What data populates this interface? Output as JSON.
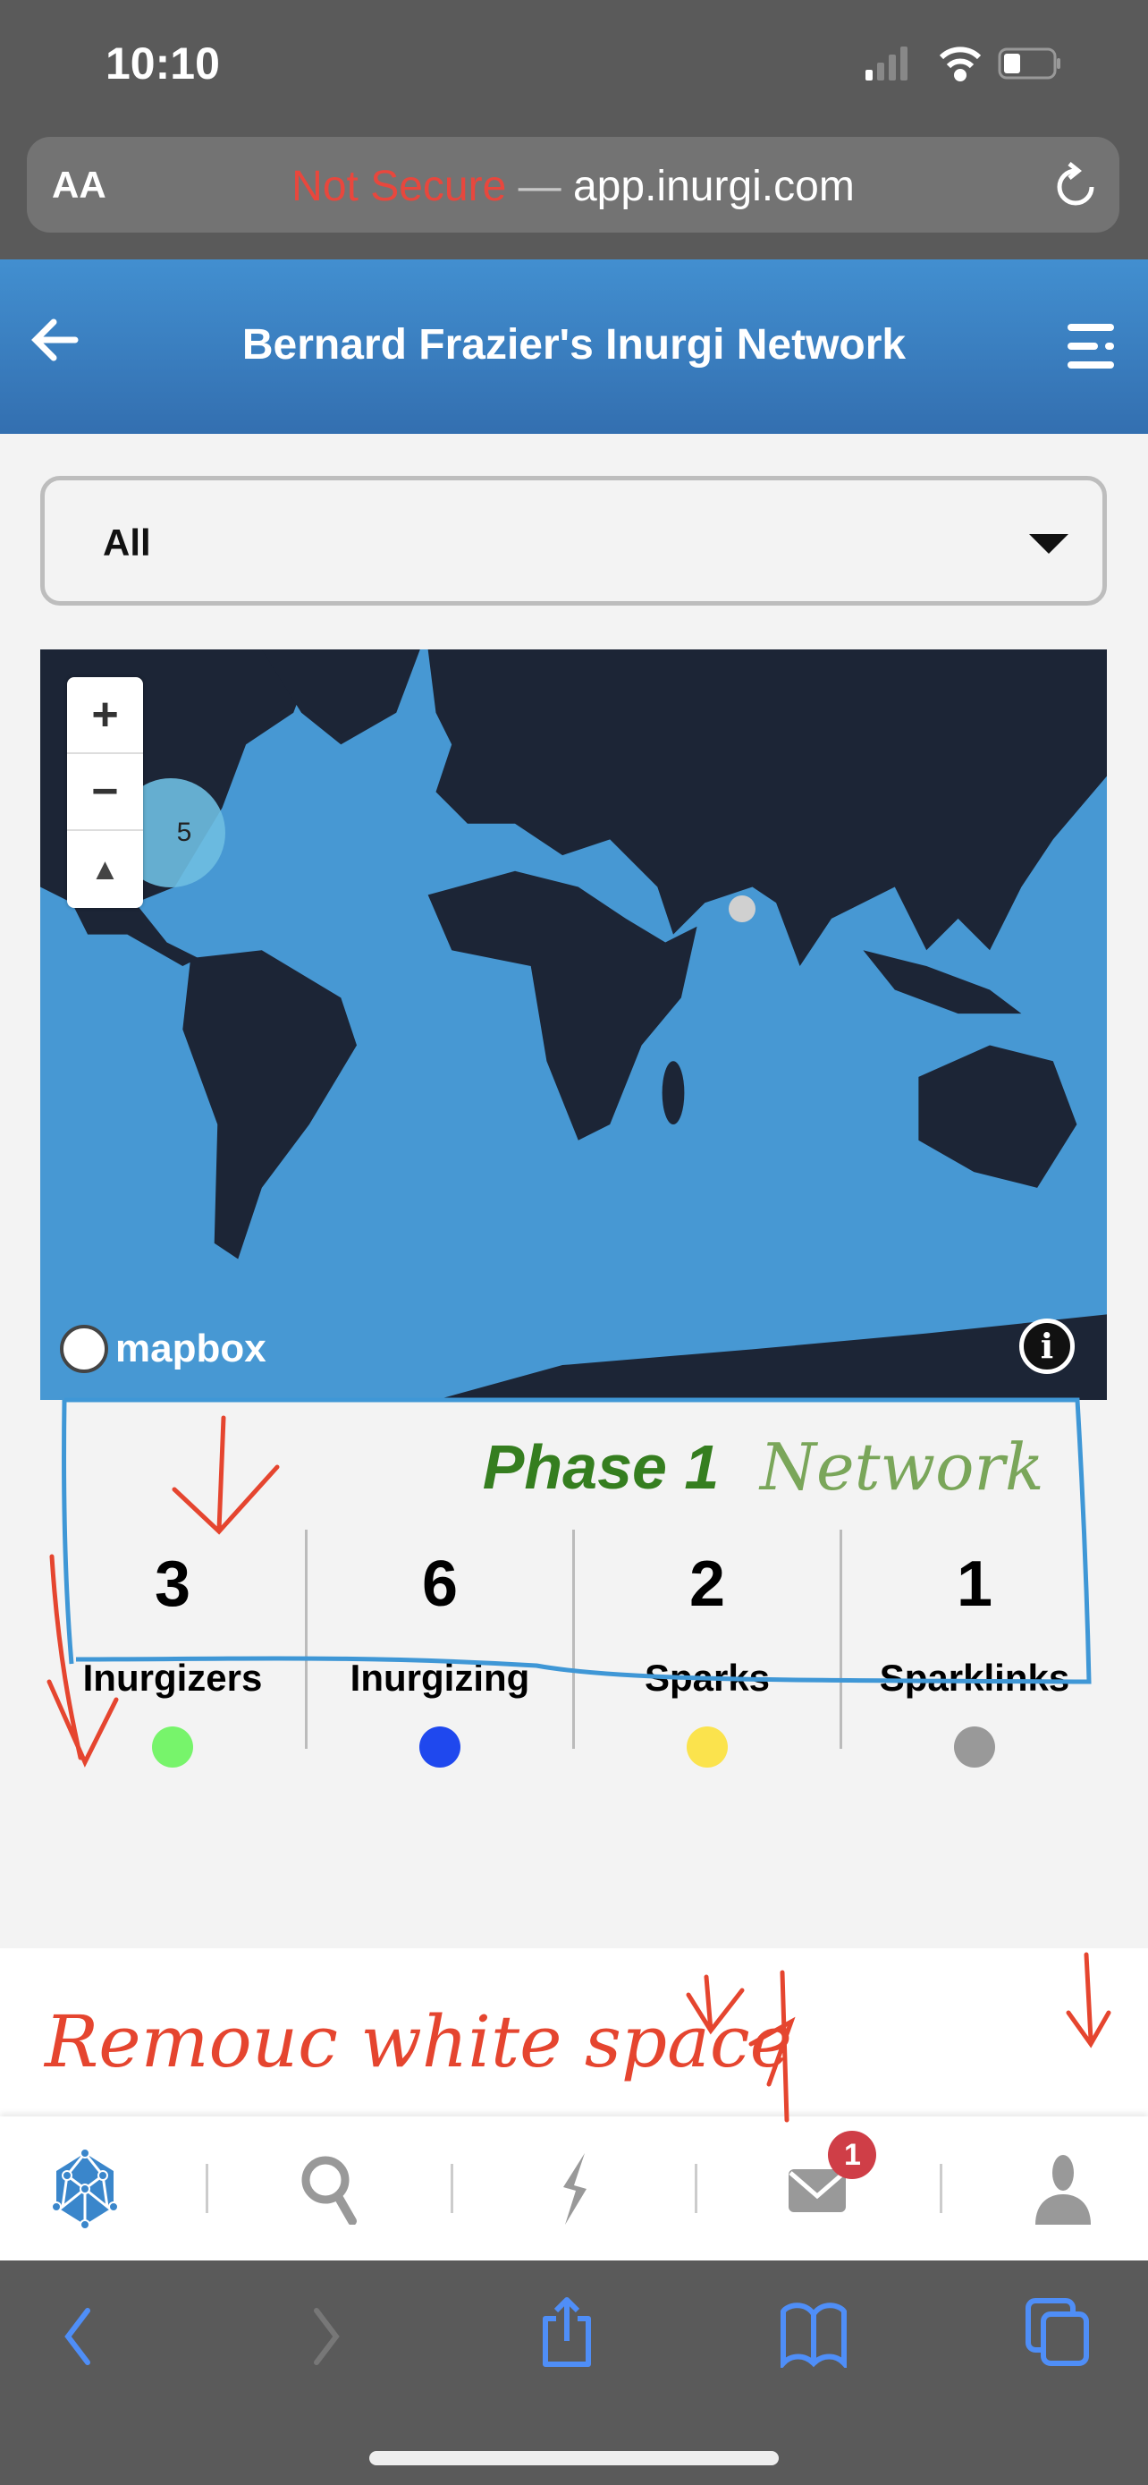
{
  "status_bar": {
    "time": "10:10",
    "signal_icon": "cellular-signal-icon",
    "wifi_icon": "wifi-icon",
    "battery_icon": "battery-icon"
  },
  "browser": {
    "text_size_label": "AA",
    "security_label": "Not Secure",
    "separator": "—",
    "domain": "app.inurgi.com",
    "reload_icon": "reload-icon"
  },
  "header": {
    "title": "Bernard Frazier's Inurgi Network",
    "back_icon": "arrow-left-icon",
    "menu_icon": "menu-icon"
  },
  "filter": {
    "selected": "All"
  },
  "map": {
    "zoom_in": "+",
    "zoom_out": "−",
    "compass": "▲",
    "cluster_count": "5",
    "attribution": "mapbox",
    "info": "i"
  },
  "phase": {
    "title": "Phase 1"
  },
  "stats": [
    {
      "value": "3",
      "label": "Inurgizers",
      "color": "#77f46b"
    },
    {
      "value": "6",
      "label": "Inurgizing",
      "color": "#1f48ee"
    },
    {
      "value": "2",
      "label": "Sparks",
      "color": "#fbe34d"
    },
    {
      "value": "1",
      "label": "Sparklinks",
      "color": "#999999"
    }
  ],
  "bottom_nav": {
    "items": [
      "network-icon",
      "search-icon",
      "lightning-icon",
      "mail-icon",
      "user-icon"
    ],
    "mail_badge": "1",
    "active_color": "#3a86cb"
  },
  "safari_toolbar": {
    "items": [
      "back-icon",
      "forward-icon",
      "share-icon",
      "bookmarks-icon",
      "tabs-icon"
    ],
    "color": "#4f8ef7"
  },
  "annotations": {
    "note": "Remouc white space",
    "network_note": "Network"
  }
}
